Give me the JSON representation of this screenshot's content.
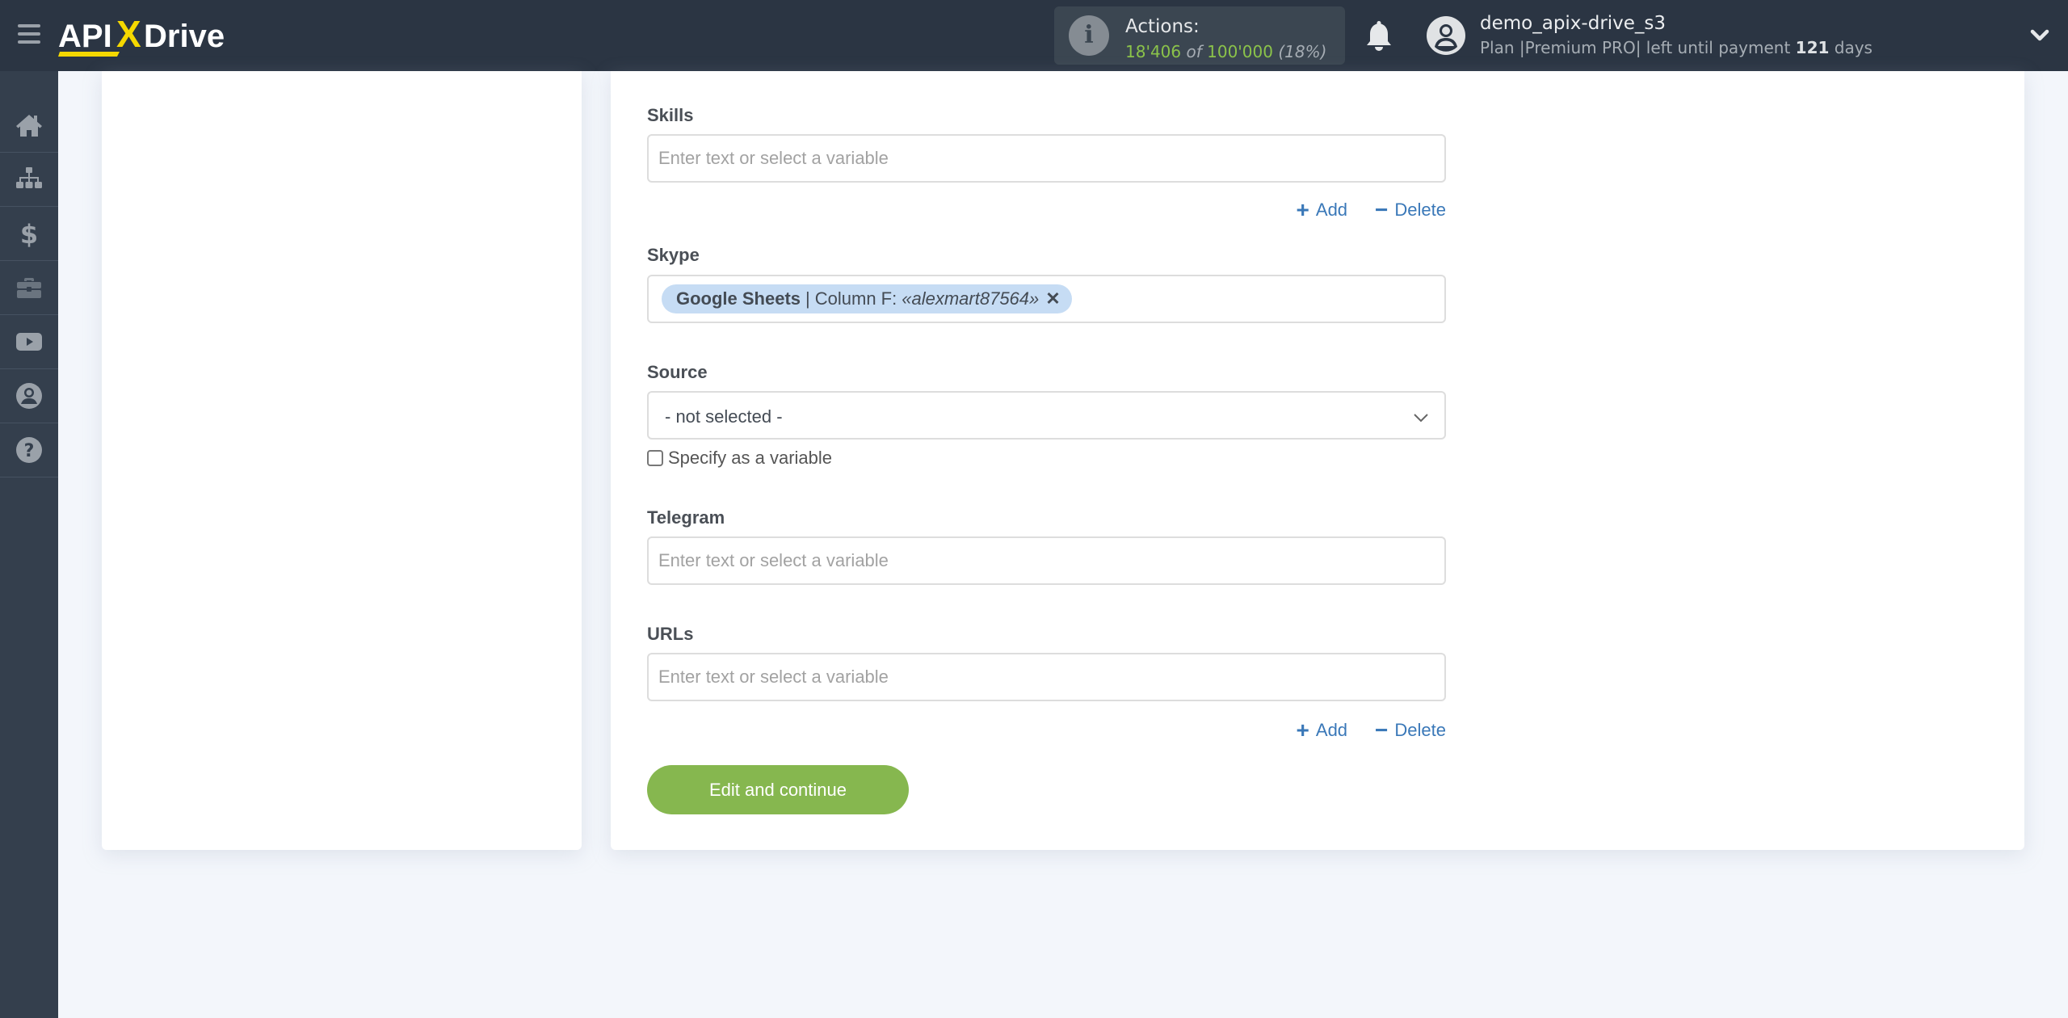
{
  "header": {
    "logo_text": {
      "api": "API",
      "x": "X",
      "drive": "Drive"
    },
    "actions": {
      "label": "Actions:",
      "used": "18'406",
      "of": "of",
      "total": "100'000",
      "percent": "(18%)"
    },
    "user": {
      "name": "demo_apix-drive_s3",
      "plan_prefix": "Plan |Premium PRO| left until payment",
      "days_left": "121",
      "days_suffix": "days"
    }
  },
  "sidebar": {
    "items": [
      {
        "icon": "home-icon"
      },
      {
        "icon": "sitemap-icon"
      },
      {
        "icon": "dollar-icon"
      },
      {
        "icon": "briefcase-icon"
      },
      {
        "icon": "youtube-icon"
      },
      {
        "icon": "user-circle-icon"
      },
      {
        "icon": "question-circle-icon"
      }
    ]
  },
  "form": {
    "skills": {
      "label": "Skills",
      "placeholder": "Enter text or select a variable",
      "value": "",
      "add_label": "Add",
      "delete_label": "Delete"
    },
    "skype": {
      "label": "Skype",
      "chip": {
        "source": "Google Sheets",
        "separator": "|",
        "column": "Column F:",
        "value": "«alexmart87564»"
      }
    },
    "source": {
      "label": "Source",
      "selected": "- not selected -",
      "checkbox_label": "Specify as a variable",
      "checkbox_checked": false
    },
    "telegram": {
      "label": "Telegram",
      "placeholder": "Enter text or select a variable",
      "value": ""
    },
    "urls": {
      "label": "URLs",
      "placeholder": "Enter text or select a variable",
      "value": "",
      "add_label": "Add",
      "delete_label": "Delete"
    },
    "submit_label": "Edit and continue"
  },
  "colors": {
    "header_bg": "#2b3543",
    "sidebar_bg": "#343f4d",
    "accent_green": "#86b74f",
    "link_blue": "#3a78b8",
    "chip_bg": "#c6dcf4",
    "logo_yellow": "#f5d800"
  }
}
